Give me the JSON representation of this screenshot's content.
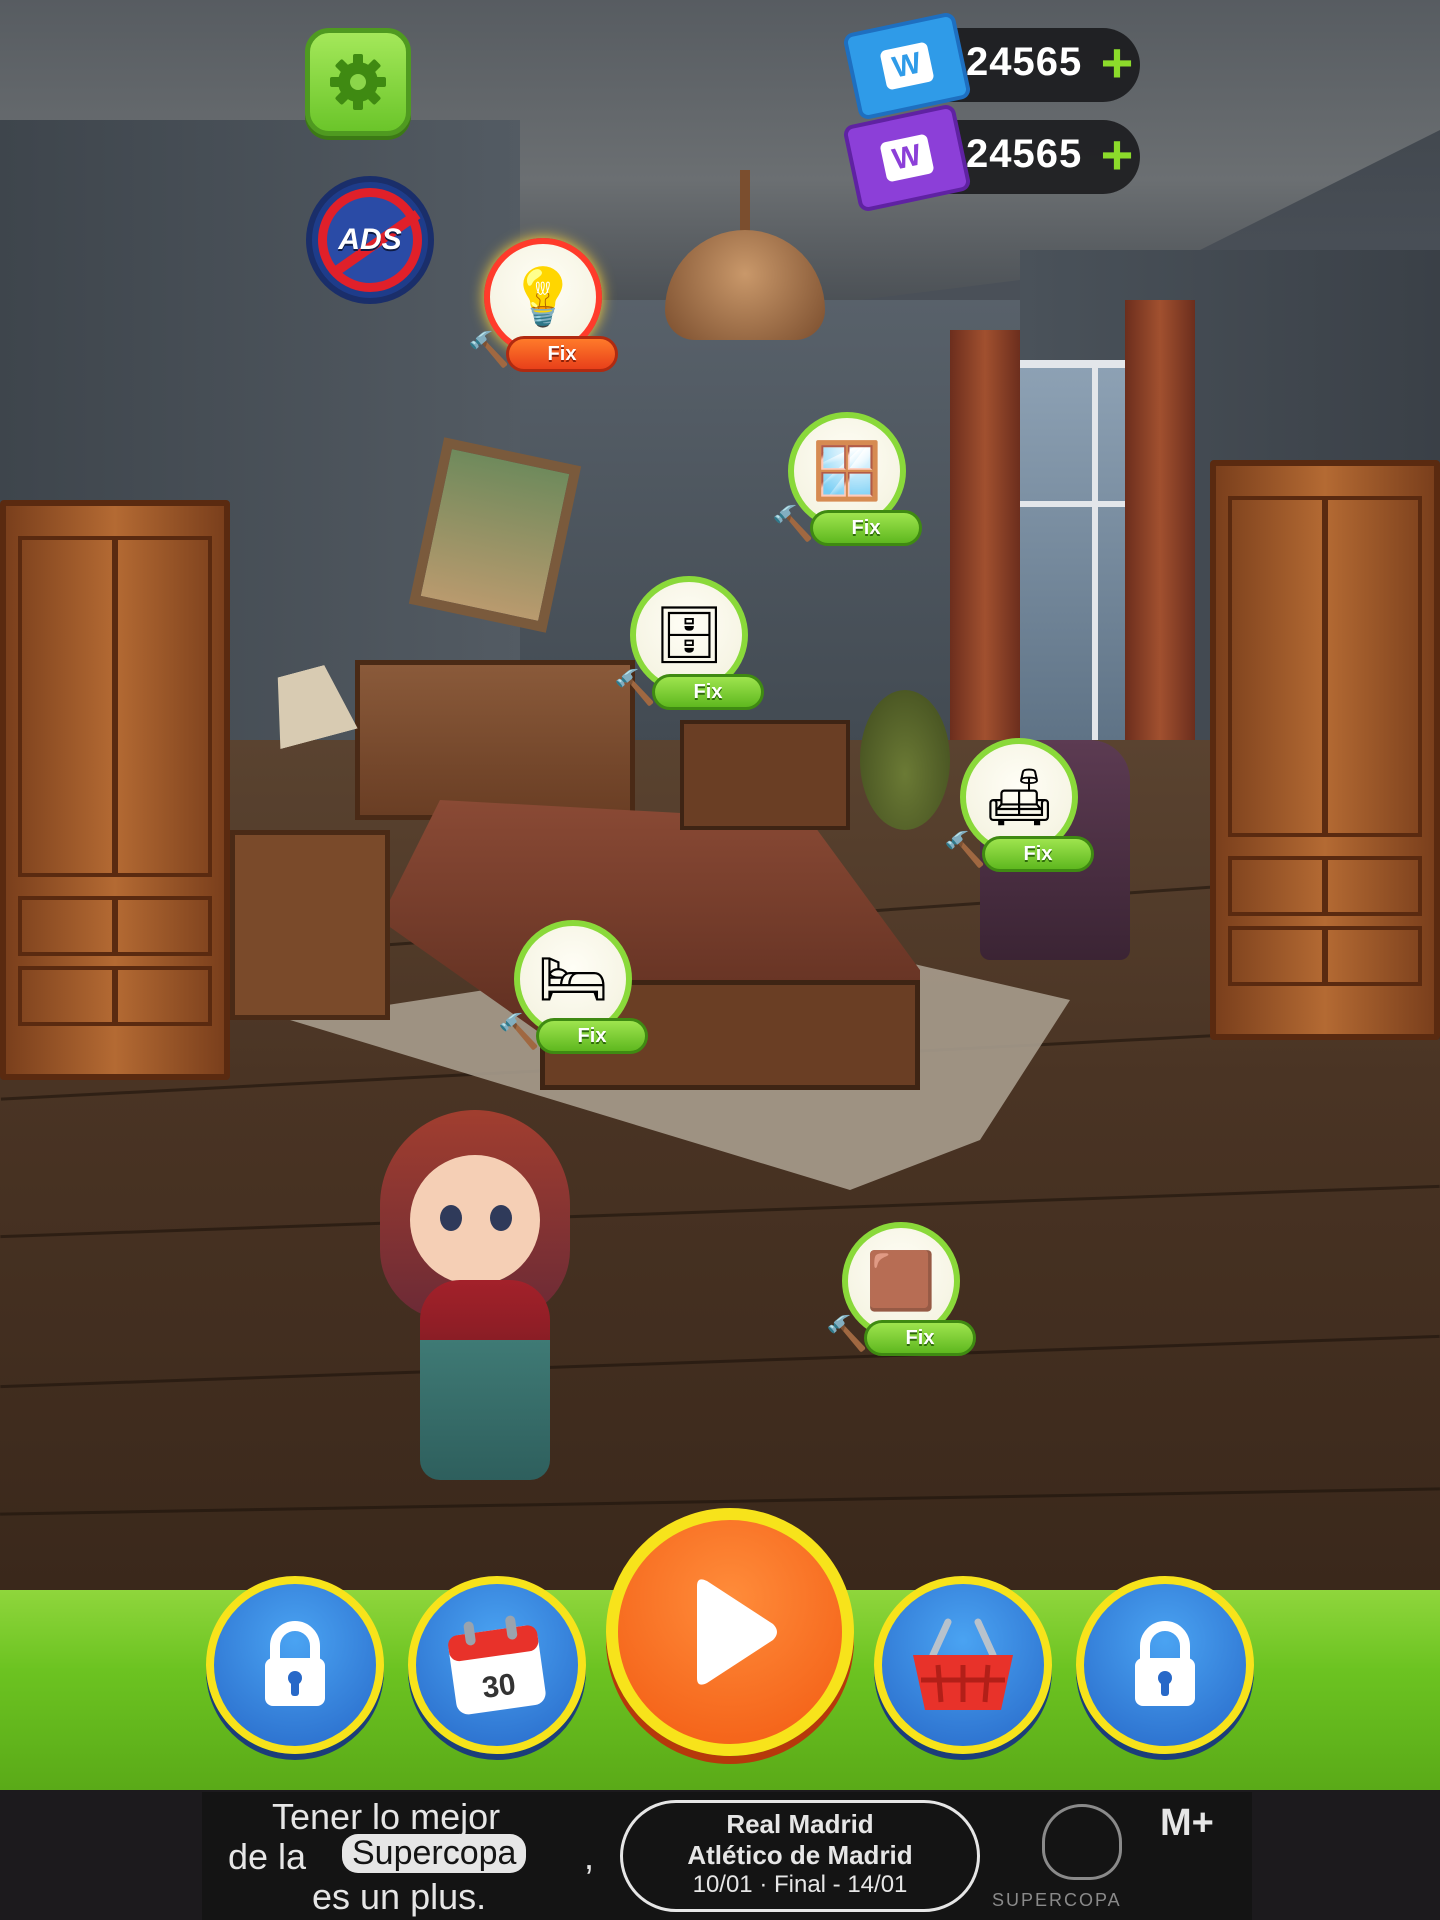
{
  "hud": {
    "settings_icon": "gear-icon",
    "no_ads_label": "ADS",
    "currencies": [
      {
        "name": "blue-ticket",
        "icon": "ticket-w-icon",
        "color": "#2f9be8",
        "value": "24565",
        "plus": "+"
      },
      {
        "name": "purple-ticket",
        "icon": "ticket-w-icon",
        "color": "#8c3fd8",
        "value": "24565",
        "plus": "+"
      }
    ],
    "ticket_letter": "W"
  },
  "fix_buttons": [
    {
      "item": "ceiling-lamp",
      "icon": "ceiling-lamp-icon",
      "label": "Fix",
      "state": "highlighted"
    },
    {
      "item": "curtains",
      "icon": "curtains-icon",
      "label": "Fix",
      "state": "normal"
    },
    {
      "item": "nightstand",
      "icon": "cabinet-icon",
      "label": "Fix",
      "state": "normal"
    },
    {
      "item": "armchair",
      "icon": "armchair-icon",
      "label": "Fix",
      "state": "normal"
    },
    {
      "item": "bed",
      "icon": "bed-icon",
      "label": "Fix",
      "state": "normal"
    },
    {
      "item": "floor",
      "icon": "floor-tiles-icon",
      "label": "Fix",
      "state": "normal"
    }
  ],
  "bottom_nav": [
    {
      "name": "locked-slot-left",
      "icon": "lock-icon",
      "locked": true
    },
    {
      "name": "daily-calendar",
      "icon": "calendar-icon",
      "calendar_day": "30"
    },
    {
      "name": "play",
      "icon": "play-icon"
    },
    {
      "name": "shop",
      "icon": "basket-icon"
    },
    {
      "name": "locked-slot-right",
      "icon": "lock-icon",
      "locked": true
    }
  ],
  "ad": {
    "line1": "Tener lo mejor",
    "line2_pre": "de la",
    "line2_highlight": "Supercopa",
    "line2_post": ",",
    "line3": "es un plus.",
    "match_line1": "Real Madrid",
    "match_line2": "Atlético de Madrid",
    "match_line3": "10/01  ·  Final - 14/01",
    "brand": "M+",
    "logo_text": "SUPERCOPA"
  },
  "colors": {
    "accent_green": "#8cdb2b",
    "button_yellow_ring": "#f7e31b",
    "play_orange": "#f25a12",
    "nav_blue": "#2768c8"
  }
}
